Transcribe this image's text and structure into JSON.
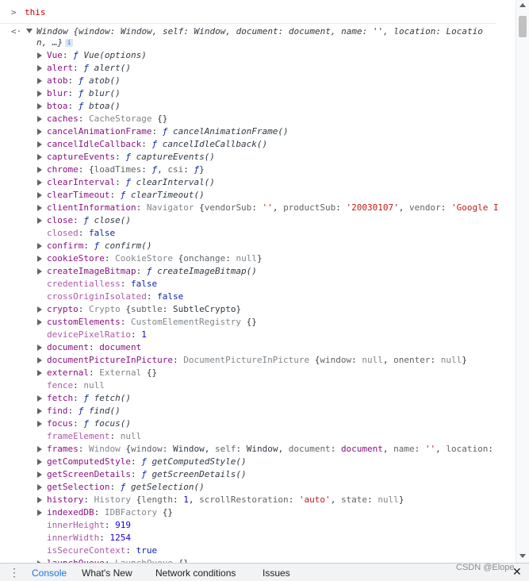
{
  "input": {
    "prompt_glyph": ">",
    "command": "this"
  },
  "result": {
    "arrow_glyph": "<·",
    "summary_line1": "Window {window: Window, self: Window, document: document, name: '', location: Locatio",
    "summary_line2": "n, …}",
    "info_badge": "i"
  },
  "props": [
    {
      "key": "Vue",
      "parts": [
        [
          "fn",
          "ƒ "
        ],
        [
          "fnname",
          "Vue(options)"
        ]
      ],
      "exp": true
    },
    {
      "key": "alert",
      "parts": [
        [
          "fn",
          "ƒ "
        ],
        [
          "fnname",
          "alert()"
        ]
      ],
      "exp": true
    },
    {
      "key": "atob",
      "parts": [
        [
          "fn",
          "ƒ "
        ],
        [
          "fnname",
          "atob()"
        ]
      ],
      "exp": true
    },
    {
      "key": "blur",
      "parts": [
        [
          "fn",
          "ƒ "
        ],
        [
          "fnname",
          "blur()"
        ]
      ],
      "exp": true,
      "hl": true
    },
    {
      "key": "btoa",
      "parts": [
        [
          "fn",
          "ƒ "
        ],
        [
          "fnname",
          "btoa()"
        ]
      ],
      "exp": true
    },
    {
      "key": "caches",
      "parts": [
        [
          "cls",
          "CacheStorage "
        ],
        [
          "obj",
          "{}"
        ]
      ],
      "exp": true
    },
    {
      "key": "cancelAnimationFrame",
      "parts": [
        [
          "fn",
          "ƒ "
        ],
        [
          "fnname",
          "cancelAnimationFrame()"
        ]
      ],
      "exp": true
    },
    {
      "key": "cancelIdleCallback",
      "parts": [
        [
          "fn",
          "ƒ "
        ],
        [
          "fnname",
          "cancelIdleCallback()"
        ]
      ],
      "exp": true
    },
    {
      "key": "captureEvents",
      "parts": [
        [
          "fn",
          "ƒ "
        ],
        [
          "fnname",
          "captureEvents()"
        ]
      ],
      "exp": true
    },
    {
      "key": "chrome",
      "parts": [
        [
          "obj",
          "{"
        ],
        [
          "ikey",
          "loadTimes"
        ],
        [
          "obj",
          ": "
        ],
        [
          "fn",
          "ƒ"
        ],
        [
          "obj",
          ", "
        ],
        [
          "ikey",
          "csi"
        ],
        [
          "obj",
          ": "
        ],
        [
          "fn",
          "ƒ"
        ],
        [
          "obj",
          "}"
        ]
      ],
      "exp": true
    },
    {
      "key": "clearInterval",
      "parts": [
        [
          "fn",
          "ƒ "
        ],
        [
          "fnname",
          "clearInterval()"
        ]
      ],
      "exp": true
    },
    {
      "key": "clearTimeout",
      "parts": [
        [
          "fn",
          "ƒ "
        ],
        [
          "fnname",
          "clearTimeout()"
        ]
      ],
      "exp": true
    },
    {
      "key": "clientInformation",
      "parts": [
        [
          "cls",
          "Navigator "
        ],
        [
          "obj",
          "{"
        ],
        [
          "ikey",
          "vendorSub"
        ],
        [
          "obj",
          ": "
        ],
        [
          "str",
          "''"
        ],
        [
          "obj",
          ", "
        ],
        [
          "ikey",
          "productSub"
        ],
        [
          "obj",
          ": "
        ],
        [
          "str",
          "'20030107'"
        ],
        [
          "obj",
          ", "
        ],
        [
          "ikey",
          "vendor"
        ],
        [
          "obj",
          ": "
        ],
        [
          "str",
          "'Google I"
        ]
      ],
      "exp": true
    },
    {
      "key": "close",
      "parts": [
        [
          "fn",
          "ƒ "
        ],
        [
          "fnname",
          "close()"
        ]
      ],
      "exp": true
    },
    {
      "key": "closed",
      "parts": [
        [
          "bool",
          "false"
        ]
      ],
      "exp": false
    },
    {
      "key": "confirm",
      "parts": [
        [
          "fn",
          "ƒ "
        ],
        [
          "fnname",
          "confirm()"
        ]
      ],
      "exp": true
    },
    {
      "key": "cookieStore",
      "parts": [
        [
          "cls",
          "CookieStore "
        ],
        [
          "obj",
          "{"
        ],
        [
          "ikey",
          "onchange"
        ],
        [
          "obj",
          ": "
        ],
        [
          "nul",
          "null"
        ],
        [
          "obj",
          "}"
        ]
      ],
      "exp": true
    },
    {
      "key": "createImageBitmap",
      "parts": [
        [
          "fn",
          "ƒ "
        ],
        [
          "fnname",
          "createImageBitmap()"
        ]
      ],
      "exp": true
    },
    {
      "key": "credentialless",
      "parts": [
        [
          "bool",
          "false"
        ]
      ],
      "exp": false
    },
    {
      "key": "crossOriginIsolated",
      "parts": [
        [
          "bool",
          "false"
        ]
      ],
      "exp": false
    },
    {
      "key": "crypto",
      "parts": [
        [
          "cls",
          "Crypto "
        ],
        [
          "obj",
          "{"
        ],
        [
          "ikey",
          "subtle"
        ],
        [
          "obj",
          ": SubtleCrypto}"
        ]
      ],
      "exp": true
    },
    {
      "key": "customElements",
      "parts": [
        [
          "cls",
          "CustomElementRegistry "
        ],
        [
          "obj",
          "{}"
        ]
      ],
      "exp": true
    },
    {
      "key": "devicePixelRatio",
      "parts": [
        [
          "num",
          "1"
        ]
      ],
      "exp": false
    },
    {
      "key": "document",
      "parts": [
        [
          "key",
          "document"
        ]
      ],
      "exp": true
    },
    {
      "key": "documentPictureInPicture",
      "parts": [
        [
          "cls",
          "DocumentPictureInPicture "
        ],
        [
          "obj",
          "{"
        ],
        [
          "ikey",
          "window"
        ],
        [
          "obj",
          ": "
        ],
        [
          "nul",
          "null"
        ],
        [
          "obj",
          ", "
        ],
        [
          "ikey",
          "onenter"
        ],
        [
          "obj",
          ": "
        ],
        [
          "nul",
          "null"
        ],
        [
          "obj",
          "}"
        ]
      ],
      "exp": true
    },
    {
      "key": "external",
      "parts": [
        [
          "cls",
          "External "
        ],
        [
          "obj",
          "{}"
        ]
      ],
      "exp": true
    },
    {
      "key": "fence",
      "parts": [
        [
          "nul",
          "null"
        ]
      ],
      "exp": false
    },
    {
      "key": "fetch",
      "parts": [
        [
          "fn",
          "ƒ "
        ],
        [
          "fnname",
          "fetch()"
        ]
      ],
      "exp": true
    },
    {
      "key": "find",
      "parts": [
        [
          "fn",
          "ƒ "
        ],
        [
          "fnname",
          "find()"
        ]
      ],
      "exp": true
    },
    {
      "key": "focus",
      "parts": [
        [
          "fn",
          "ƒ "
        ],
        [
          "fnname",
          "focus()"
        ]
      ],
      "exp": true
    },
    {
      "key": "frameElement",
      "parts": [
        [
          "nul",
          "null"
        ]
      ],
      "exp": false
    },
    {
      "key": "frames",
      "parts": [
        [
          "cls",
          "Window "
        ],
        [
          "obj",
          "{"
        ],
        [
          "ikey",
          "window"
        ],
        [
          "obj",
          ": Window, "
        ],
        [
          "ikey",
          "self"
        ],
        [
          "obj",
          ": Window, "
        ],
        [
          "ikey",
          "document"
        ],
        [
          "obj",
          ": "
        ],
        [
          "key",
          "document"
        ],
        [
          "obj",
          ", "
        ],
        [
          "ikey",
          "name"
        ],
        [
          "obj",
          ": "
        ],
        [
          "str",
          "''"
        ],
        [
          "obj",
          ", "
        ],
        [
          "ikey",
          "location"
        ],
        [
          "obj",
          ":"
        ]
      ],
      "exp": true
    },
    {
      "key": "getComputedStyle",
      "parts": [
        [
          "fn",
          "ƒ "
        ],
        [
          "fnname",
          "getComputedStyle()"
        ]
      ],
      "exp": true
    },
    {
      "key": "getScreenDetails",
      "parts": [
        [
          "fn",
          "ƒ "
        ],
        [
          "fnname",
          "getScreenDetails()"
        ]
      ],
      "exp": true
    },
    {
      "key": "getSelection",
      "parts": [
        [
          "fn",
          "ƒ "
        ],
        [
          "fnname",
          "getSelection()"
        ]
      ],
      "exp": true
    },
    {
      "key": "history",
      "parts": [
        [
          "cls",
          "History "
        ],
        [
          "obj",
          "{"
        ],
        [
          "ikey",
          "length"
        ],
        [
          "obj",
          ": "
        ],
        [
          "num",
          "1"
        ],
        [
          "obj",
          ", "
        ],
        [
          "ikey",
          "scrollRestoration"
        ],
        [
          "obj",
          ": "
        ],
        [
          "str",
          "'auto'"
        ],
        [
          "obj",
          ", "
        ],
        [
          "ikey",
          "state"
        ],
        [
          "obj",
          ": "
        ],
        [
          "nul",
          "null"
        ],
        [
          "obj",
          "}"
        ]
      ],
      "exp": true
    },
    {
      "key": "indexedDB",
      "parts": [
        [
          "cls",
          "IDBFactory "
        ],
        [
          "obj",
          "{}"
        ]
      ],
      "exp": true
    },
    {
      "key": "innerHeight",
      "parts": [
        [
          "num",
          "919"
        ]
      ],
      "exp": false
    },
    {
      "key": "innerWidth",
      "parts": [
        [
          "num",
          "1254"
        ]
      ],
      "exp": false
    },
    {
      "key": "isSecureContext",
      "parts": [
        [
          "bool",
          "true"
        ]
      ],
      "exp": false
    },
    {
      "key": "launchQueue",
      "parts": [
        [
          "cls",
          "LaunchQueue "
        ],
        [
          "obj",
          "{}"
        ]
      ],
      "exp": true
    }
  ],
  "drawer": {
    "menu_glyph": "⋮",
    "tabs": [
      "Console",
      "What's New",
      "Network conditions",
      "Issues"
    ],
    "watermark": "CSDN @Elope",
    "close_glyph": "✕"
  },
  "colors": {
    "key": "#881280",
    "fn": "#0d22aa",
    "string": "#c41a16",
    "number": "#1c00cf",
    "accent": "#1a73e8"
  }
}
